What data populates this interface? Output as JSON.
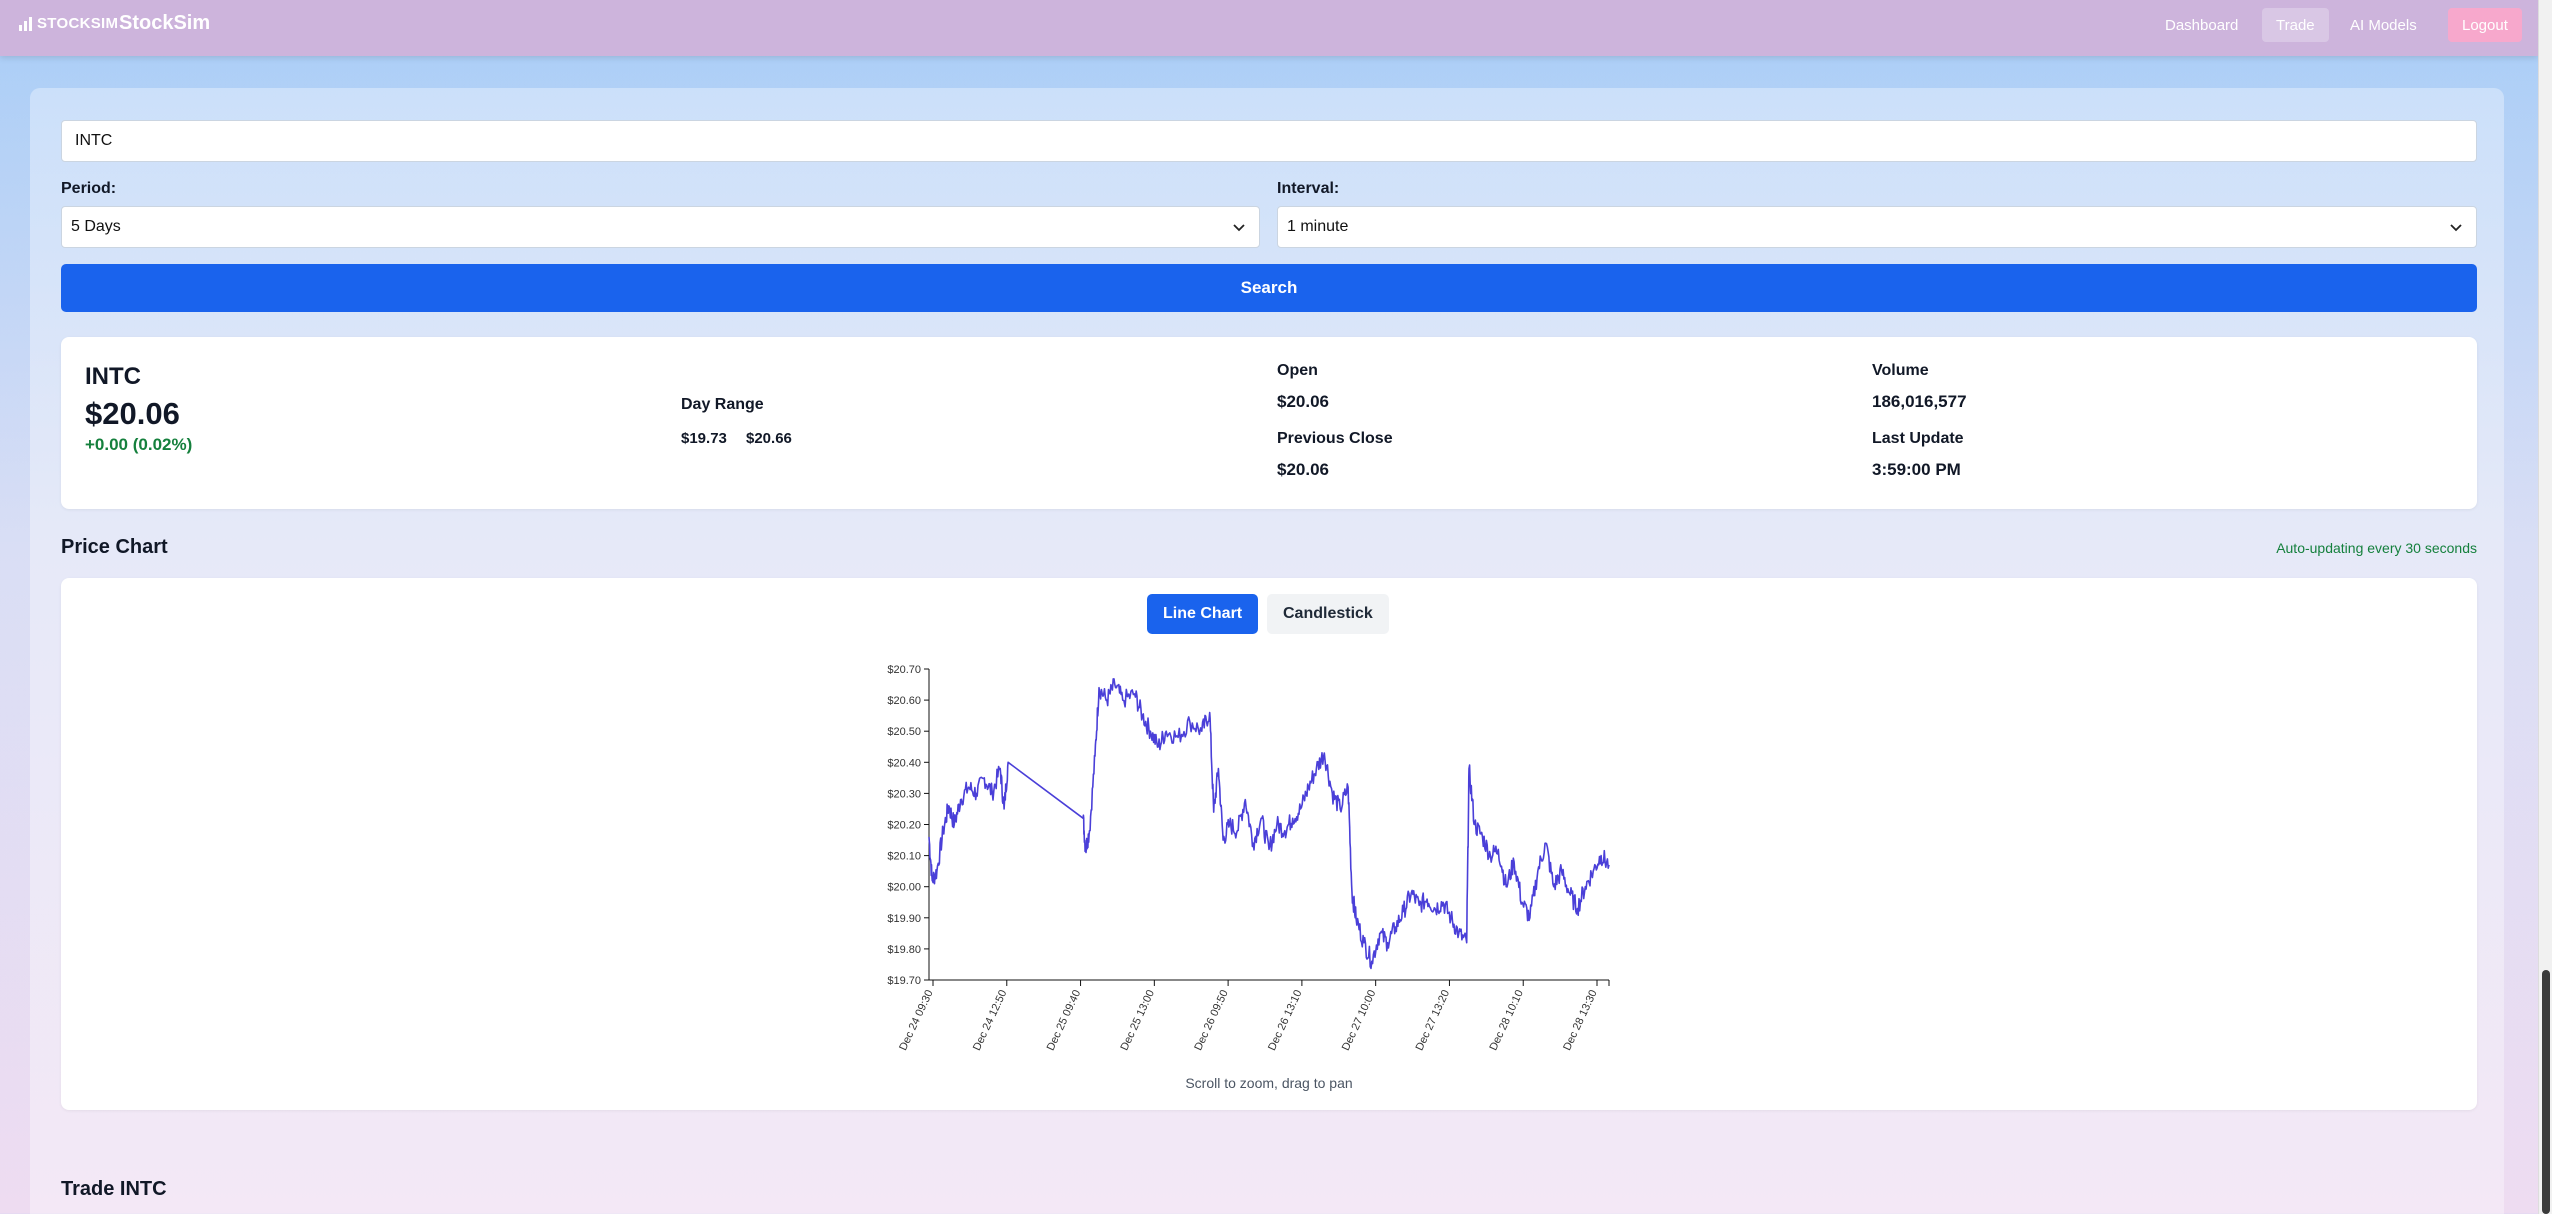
{
  "nav": {
    "logo_text": "STOCKSIM",
    "brand": "StockSim",
    "links": [
      "Dashboard",
      "Trade",
      "AI Models"
    ],
    "active": "Trade",
    "logout": "Logout"
  },
  "search": {
    "ticker_value": "INTC",
    "period_label": "Period:",
    "period_value": "5 Days",
    "interval_label": "Interval:",
    "interval_value": "1 minute",
    "button": "Search"
  },
  "quote": {
    "symbol": "INTC",
    "price": "$20.06",
    "change": "+0.00 (0.02%)",
    "day_range_label": "Day Range",
    "day_low": "$19.73",
    "day_high": "$20.66",
    "open_label": "Open",
    "open": "$20.06",
    "prev_close_label": "Previous Close",
    "prev_close": "$20.06",
    "volume_label": "Volume",
    "volume": "186,016,577",
    "last_update_label": "Last Update",
    "last_update": "3:59:00 PM"
  },
  "chart_section": {
    "title": "Price Chart",
    "auto_update": "Auto-updating every 30 seconds",
    "tabs": [
      "Line Chart",
      "Candlestick"
    ],
    "active_tab": "Line Chart",
    "hint": "Scroll to zoom, drag to pan"
  },
  "trade_section": {
    "title": "Trade INTC"
  },
  "colors": {
    "line": "#4a3fd8",
    "accent": "#1a63ed",
    "nav_bg": "#cdb4dc",
    "positive": "#15803d"
  },
  "chart_data": {
    "type": "line",
    "title": "",
    "xlabel": "",
    "ylabel": "",
    "ylim": [
      19.7,
      20.7
    ],
    "yticks": [
      19.7,
      19.8,
      19.9,
      20.0,
      20.1,
      20.2,
      20.3,
      20.4,
      20.5,
      20.6,
      20.7
    ],
    "ytick_labels": [
      "$19.70",
      "$19.80",
      "$19.90",
      "$20.00",
      "$20.10",
      "$20.20",
      "$20.30",
      "$20.40",
      "$20.50",
      "$20.60",
      "$20.70"
    ],
    "xtick_labels": [
      "Dec 24 09:30",
      "Dec 24 12:50",
      "Dec 25 09:40",
      "Dec 25 13:00",
      "Dec 26 09:50",
      "Dec 26 13:10",
      "Dec 27 10:00",
      "Dec 27 13:20",
      "Dec 28 10:10",
      "Dec 28 13:30"
    ],
    "series": [
      {
        "values": [
          [
            0.0,
            20.16
          ],
          [
            0.4,
            20.02
          ],
          [
            1.0,
            20.05
          ],
          [
            1.8,
            20.18
          ],
          [
            2.5,
            20.26
          ],
          [
            3.2,
            20.2
          ],
          [
            4.0,
            20.28
          ],
          [
            5.0,
            20.32
          ],
          [
            6.0,
            20.3
          ],
          [
            7.0,
            20.35
          ],
          [
            8.0,
            20.3
          ],
          [
            9.0,
            20.38
          ],
          [
            9.5,
            20.25
          ],
          [
            10.0,
            20.4
          ],
          [
            19.5,
            20.22
          ],
          [
            19.8,
            20.12
          ],
          [
            20.3,
            20.18
          ],
          [
            21.0,
            20.42
          ],
          [
            21.5,
            20.64
          ],
          [
            22.5,
            20.6
          ],
          [
            23.5,
            20.65
          ],
          [
            24.5,
            20.6
          ],
          [
            26.0,
            20.62
          ],
          [
            27.0,
            20.55
          ],
          [
            28.0,
            20.5
          ],
          [
            29.0,
            20.45
          ],
          [
            30.0,
            20.5
          ],
          [
            31.5,
            20.48
          ],
          [
            33.0,
            20.53
          ],
          [
            34.5,
            20.5
          ],
          [
            35.5,
            20.56
          ],
          [
            36.0,
            20.24
          ],
          [
            36.6,
            20.38
          ],
          [
            37.2,
            20.15
          ],
          [
            38.0,
            20.2
          ],
          [
            39.0,
            20.18
          ],
          [
            40.0,
            20.28
          ],
          [
            41.0,
            20.14
          ],
          [
            42.0,
            20.22
          ],
          [
            43.0,
            20.12
          ],
          [
            44.0,
            20.2
          ],
          [
            45.0,
            20.18
          ],
          [
            46.0,
            20.22
          ],
          [
            47.0,
            20.25
          ],
          [
            48.0,
            20.32
          ],
          [
            49.0,
            20.38
          ],
          [
            50.0,
            20.43
          ],
          [
            51.0,
            20.3
          ],
          [
            52.0,
            20.25
          ],
          [
            53.0,
            20.32
          ],
          [
            53.5,
            19.98
          ],
          [
            54.0,
            19.9
          ],
          [
            55.0,
            19.82
          ],
          [
            56.0,
            19.76
          ],
          [
            57.0,
            19.85
          ],
          [
            58.0,
            19.82
          ],
          [
            59.0,
            19.87
          ],
          [
            60.0,
            19.92
          ],
          [
            61.0,
            19.98
          ],
          [
            62.0,
            19.94
          ],
          [
            63.0,
            19.96
          ],
          [
            64.0,
            19.93
          ],
          [
            65.0,
            19.95
          ],
          [
            66.0,
            19.9
          ],
          [
            67.0,
            19.85
          ],
          [
            68.0,
            19.82
          ],
          [
            68.3,
            20.38
          ],
          [
            69.0,
            20.2
          ],
          [
            70.0,
            20.16
          ],
          [
            71.0,
            20.1
          ],
          [
            72.0,
            20.12
          ],
          [
            73.0,
            20.0
          ],
          [
            74.0,
            20.08
          ],
          [
            75.0,
            19.95
          ],
          [
            76.0,
            19.9
          ],
          [
            77.0,
            20.05
          ],
          [
            78.0,
            20.14
          ],
          [
            79.0,
            20.0
          ],
          [
            80.0,
            20.05
          ],
          [
            81.0,
            19.98
          ],
          [
            82.0,
            19.93
          ],
          [
            83.0,
            20.0
          ],
          [
            84.0,
            20.05
          ],
          [
            85.0,
            20.1
          ],
          [
            86.0,
            20.07
          ]
        ]
      }
    ],
    "x_domain": [
      0,
      86
    ],
    "grid": false,
    "legend": "none"
  }
}
